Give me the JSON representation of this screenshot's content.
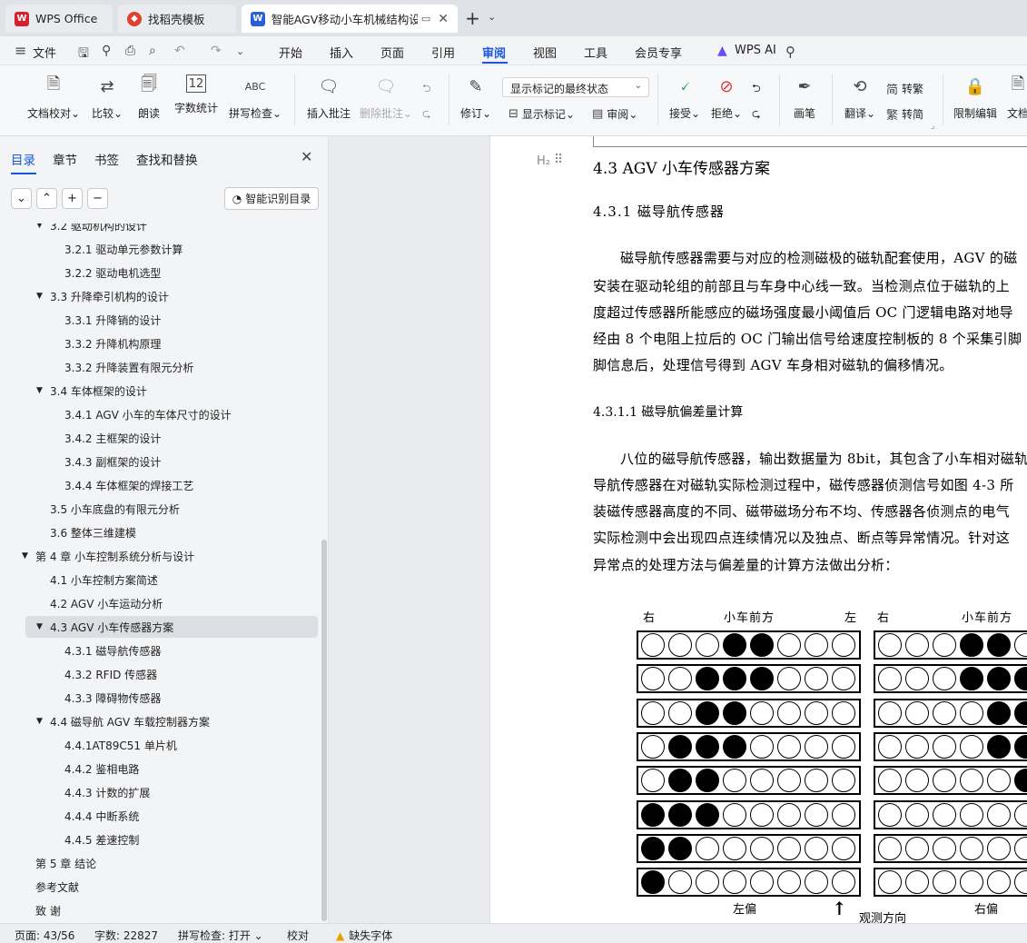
{
  "tabs": [
    {
      "label": "WPS Office",
      "icon": "wps-logo-icon"
    },
    {
      "label": "找稻壳模板",
      "icon": "docer-icon"
    },
    {
      "label": "智能AGV移动小车机械结构设",
      "icon": "word-doc-icon",
      "icon_letter": "W"
    }
  ],
  "menu": {
    "file": "文件",
    "items": [
      "开始",
      "插入",
      "页面",
      "引用",
      "审阅",
      "视图",
      "工具",
      "会员专享"
    ],
    "active": "审阅",
    "wps_ai": "WPS AI"
  },
  "ribbon": {
    "doc_check": "文档校对",
    "compare": "比较",
    "read_aloud": "朗读",
    "word_count": "字数统计",
    "spell_check": "拼写检查",
    "insert_comment": "插入批注",
    "delete_comment": "删除批注",
    "revise": "修订",
    "markup_state": "显示标记的最终状态",
    "show_markup": "显示标记",
    "review": "审阅",
    "accept": "接受",
    "reject": "拒绝",
    "pen": "画笔",
    "translate": "翻译",
    "to_traditional": "转繁",
    "to_simplified": "转简",
    "restrict_edit": "限制编辑",
    "doc_rights": "文档",
    "spell_icon_text": "ABC",
    "count_icon_text": "12"
  },
  "nav": {
    "tabs": [
      "目录",
      "章节",
      "书签",
      "查找和替换"
    ],
    "active_tab": "目录",
    "smart_toc": "智能识别目录",
    "toc": [
      {
        "text": "3.2  驱动机构的设计",
        "level": 2,
        "caret": true
      },
      {
        "text": "3.2.1  驱动单元参数计算",
        "level": 3
      },
      {
        "text": "3.2.2  驱动电机选型",
        "level": 3
      },
      {
        "text": "3.3  升降牵引机构的设计",
        "level": 2,
        "caret": true
      },
      {
        "text": "3.3.1 升降销的设计",
        "level": 3
      },
      {
        "text": "3.3.2  升降机构原理",
        "level": 3
      },
      {
        "text": "3.3.2  升降装置有限元分析",
        "level": 3
      },
      {
        "text": "3.4  车体框架的设计",
        "level": 2,
        "caret": true
      },
      {
        "text": "3.4.1 AGV 小车的车体尺寸的设计",
        "level": 3
      },
      {
        "text": "3.4.2  主框架的设计",
        "level": 3
      },
      {
        "text": "3.4.3  副框架的设计",
        "level": 3
      },
      {
        "text": "3.4.4  车体框架的焊接工艺",
        "level": 3
      },
      {
        "text": "3.5 小车底盘的有限元分析",
        "level": 2
      },
      {
        "text": "3.6  整体三维建模",
        "level": 2
      },
      {
        "text": "第 4 章  小车控制系统分析与设计",
        "level": 1,
        "caret": true
      },
      {
        "text": "4.1  小车控制方案简述",
        "level": 2
      },
      {
        "text": "4.2 AGV 小车运动分析",
        "level": 2
      },
      {
        "text": "4.3 AGV 小车传感器方案",
        "level": 2,
        "caret": true,
        "selected": true
      },
      {
        "text": "4.3.1 磁导航传感器",
        "level": 3
      },
      {
        "text": "4.3.2 RFID 传感器",
        "level": 3
      },
      {
        "text": "4.3.3  障碍物传感器",
        "level": 3
      },
      {
        "text": "4.4  磁导航 AGV 车载控制器方案",
        "level": 2,
        "caret": true
      },
      {
        "text": "4.4.1AT89C51 单片机",
        "level": 3
      },
      {
        "text": "4.4.2  鉴相电路",
        "level": 3
      },
      {
        "text": "4.4.3 计数的扩展",
        "level": 3
      },
      {
        "text": "4.4.4  中断系统",
        "level": 3
      },
      {
        "text": "4.4.5  差速控制",
        "level": 3
      },
      {
        "text": "第 5 章   结论",
        "level": 1
      },
      {
        "text": "参考文献",
        "level": 1
      },
      {
        "text": "致   谢",
        "level": 1
      }
    ]
  },
  "doc": {
    "heading_marker": "H₂",
    "h3": "4.3 AGV 小车传感器方案",
    "h4": "4.3.1  磁导航传感器",
    "para1": [
      "磁导航传感器需要与对应的检测磁极的磁轨配套使用，AGV 的磁",
      "安装在驱动轮组的前部且与车身中心线一致。当检测点位于磁轨的上",
      "度超过传感器所能感应的磁场强度最小阈值后 OC 门逻辑电路对地导",
      "经由  8  个电阻上拉后的 OC 门输出信号给速度控制板的 8 个采集引脚",
      "脚信息后，处理信号得到  AGV  车身相对磁轨的偏移情况。"
    ],
    "h5": "4.3.1.1 磁导航偏差量计算",
    "para2": [
      "八位的磁导航传感器，输出数据量为   8bit，其包含了小车相对磁轨",
      "导航传感器在对磁轨实际检测过程中，磁传感器侦测信号如图 4-3 所",
      "装磁传感器高度的不同、磁带磁场分布不均、传感器各侦测点的电气",
      "实际检测中会出现四点连续情况以及独点、断点等异常情况。针对这",
      "异常点的处理方法与偏差量的计算方法做出分析："
    ],
    "figure": {
      "left_panel": {
        "right_label": "右",
        "top_label": "小车前方",
        "left_label": "左",
        "bottom_label": "左偏"
      },
      "right_panel": {
        "right_label": "右",
        "top_label": "小车前方",
        "bottom_label": "右偏"
      },
      "direction_label": "观测方向",
      "left_rows": [
        [
          0,
          0,
          0,
          1,
          1,
          0,
          0,
          0
        ],
        [
          0,
          0,
          1,
          1,
          1,
          0,
          0,
          0
        ],
        [
          0,
          0,
          1,
          1,
          0,
          0,
          0,
          0
        ],
        [
          0,
          1,
          1,
          1,
          0,
          0,
          0,
          0
        ],
        [
          0,
          1,
          1,
          0,
          0,
          0,
          0,
          0
        ],
        [
          1,
          1,
          1,
          0,
          0,
          0,
          0,
          0
        ],
        [
          1,
          1,
          0,
          0,
          0,
          0,
          0,
          0
        ],
        [
          1,
          0,
          0,
          0,
          0,
          0,
          0,
          0
        ]
      ],
      "right_rows": [
        [
          0,
          0,
          0,
          1,
          1,
          0
        ],
        [
          0,
          0,
          0,
          1,
          1,
          1
        ],
        [
          0,
          0,
          0,
          0,
          1,
          1
        ],
        [
          0,
          0,
          0,
          0,
          1,
          1
        ],
        [
          0,
          0,
          0,
          0,
          0,
          1
        ],
        [
          0,
          0,
          0,
          0,
          0,
          0
        ],
        [
          0,
          0,
          0,
          0,
          0,
          0
        ],
        [
          0,
          0,
          0,
          0,
          0,
          0
        ]
      ]
    }
  },
  "status": {
    "page": "页面: 43/56",
    "words": "字数: 22827",
    "spell": "拼写检查: 打开",
    "proof": "校对",
    "missing_font": "缺失字体"
  },
  "colors": {
    "accent": "#1a56db",
    "wps_red": "#d8202c",
    "word_blue": "#2b5fd9"
  }
}
